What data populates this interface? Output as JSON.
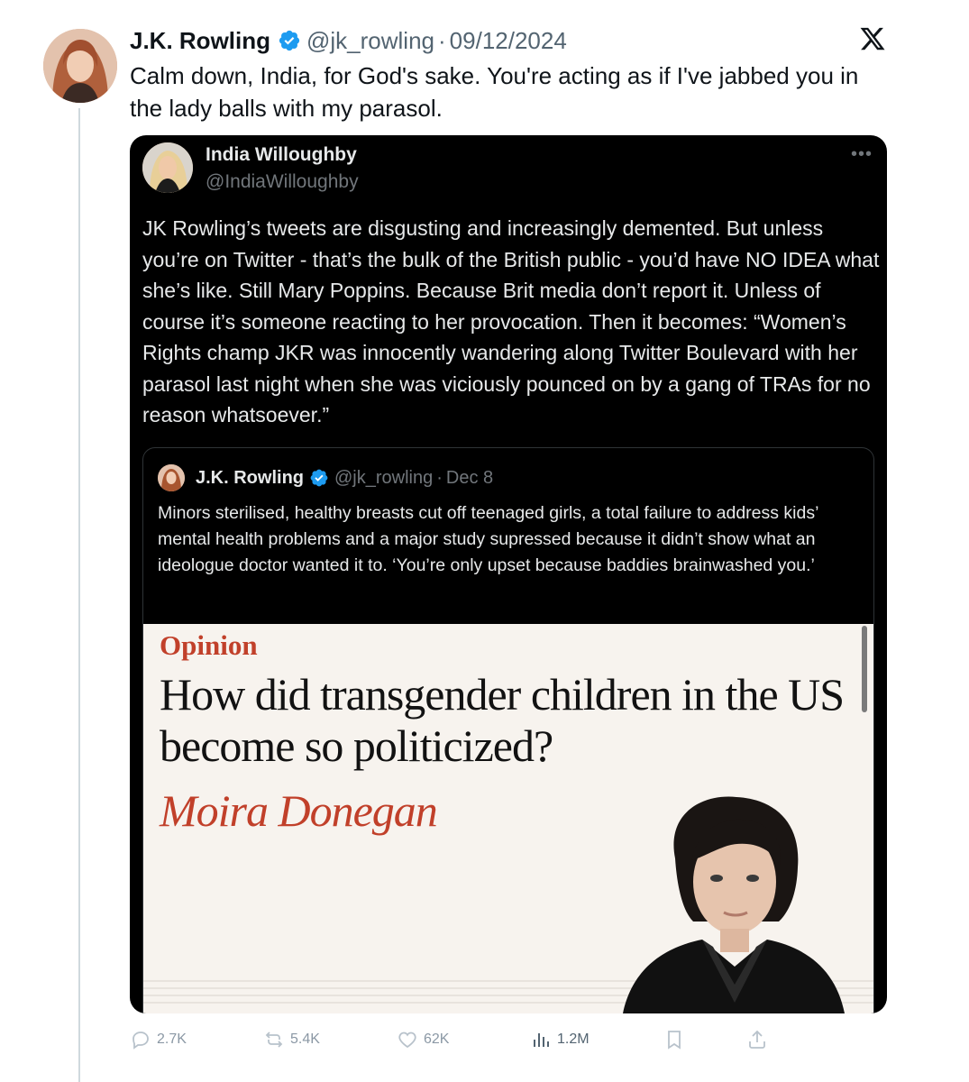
{
  "tweet": {
    "author_name": "J.K. Rowling",
    "handle": "@jk_rowling",
    "separator": "·",
    "date": "09/12/2024",
    "text": "Calm down, India, for God's sake. You're acting as if I've jabbed you in the lady balls with my parasol.",
    "platform_icon": "x-logo-icon"
  },
  "quoted_tweet": {
    "author_name": "India Willoughby",
    "handle": "@IndiaWilloughby",
    "more_label": "•••",
    "text": "JK Rowling’s tweets are disgusting and increasingly demented. But unless you’re on Twitter - that’s the bulk of the British public - you’d have NO IDEA what she’s like. Still Mary Poppins. Because Brit media don’t report it. Unless of course it’s someone reacting to her provocation. Then it becomes: “Women’s Rights champ JKR was innocently wandering along Twitter Boulevard with her parasol last night when she was viciously pounced on by a gang of TRAs for no reason whatsoever.”"
  },
  "inner_quoted_tweet": {
    "author_name": "J.K. Rowling",
    "handle": "@jk_rowling",
    "separator": "·",
    "date": "Dec 8",
    "text": "Minors sterilised, healthy breasts cut off teenaged girls, a total failure to address kids’ mental health problems and a major study supressed because it didn’t show what an ideologue doctor wanted it to. ‘You’re only upset because baddies brainwashed you.’"
  },
  "article": {
    "section": "Opinion",
    "headline": "How did transgender children in the US become so politicized?",
    "author": "Moira Donegan",
    "colors": {
      "section": "#c1402a",
      "background": "#f7f3ee"
    }
  },
  "actions": {
    "replies": "2.7K",
    "reposts": "5.4K",
    "likes": "62K",
    "views": "1.2M"
  },
  "colors": {
    "verified": "#1d9bf0",
    "muted": "#536471",
    "dark_card": "#000000"
  }
}
